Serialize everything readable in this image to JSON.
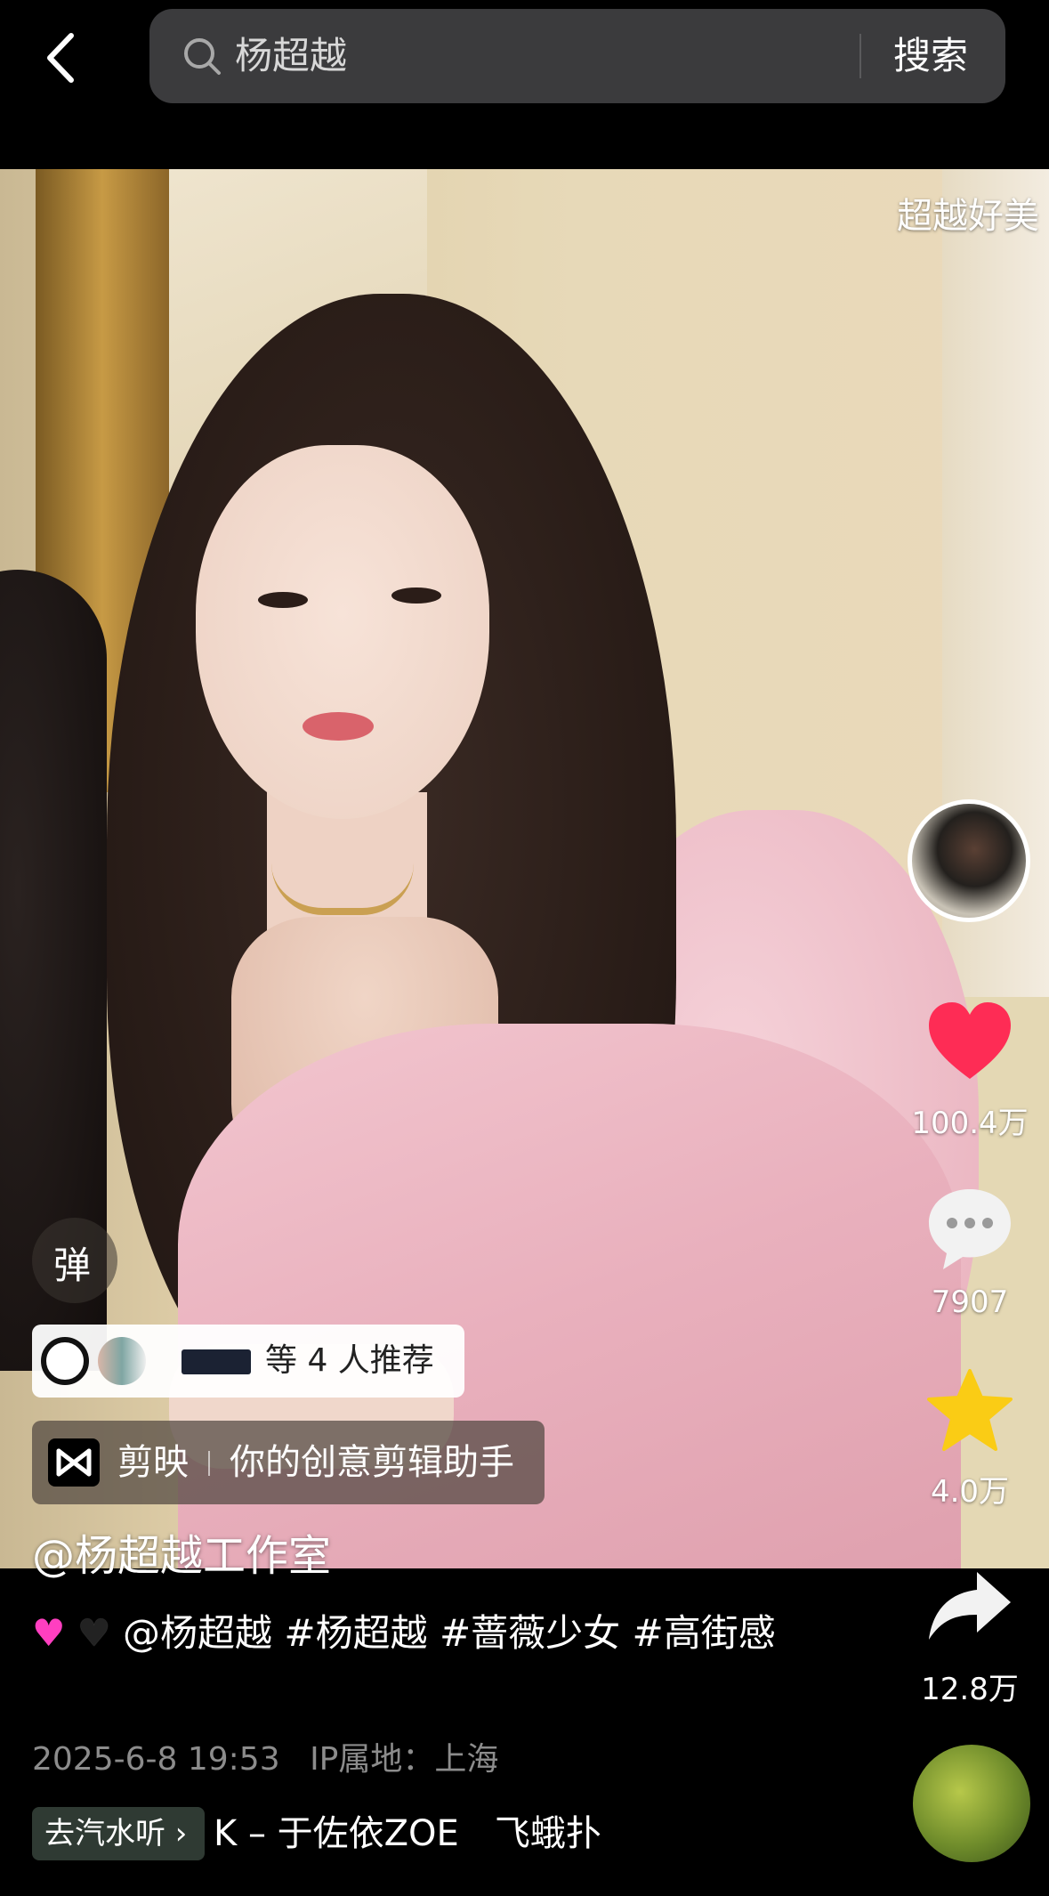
{
  "search": {
    "query": "杨超越",
    "button_label": "搜索"
  },
  "video": {
    "danmaku_preview": "超越好美",
    "danmaku_toggle_label": "弹",
    "recommend_text": "等 4 人推荐",
    "ad": {
      "app_name": "剪映",
      "slogan": "你的创意剪辑助手"
    }
  },
  "actions": {
    "like_count": "100.4万",
    "comment_count": "7907",
    "favorite_count": "4.0万",
    "share_count": "12.8万"
  },
  "post": {
    "author": "@杨超越工作室",
    "caption_mention": "@杨超越",
    "hashtags": [
      "#杨超越",
      "#蔷薇少女",
      "#高街感"
    ],
    "date": "2025-6-8 19:53",
    "ip_location": "IP属地：上海"
  },
  "music": {
    "chip_label": "去汽水听",
    "ticker_text": "K – 于佐依ZOE　飞蛾扑"
  },
  "colors": {
    "like": "#fe2c55",
    "favorite": "#facc15",
    "search_bg": "#3b3b3d"
  }
}
